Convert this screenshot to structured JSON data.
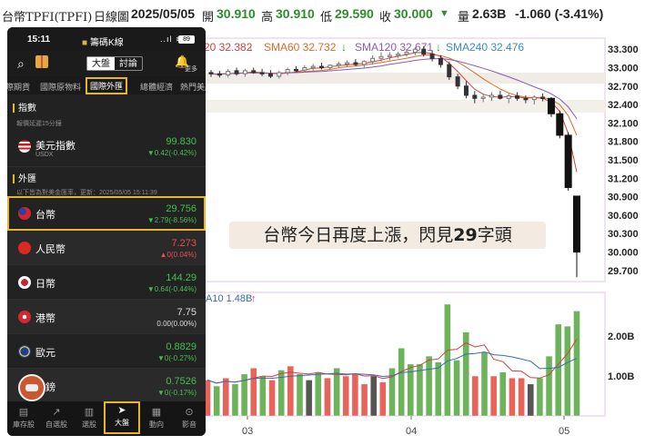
{
  "header": {
    "title": "台幣TPFI(TPFI)",
    "period": "日線圖",
    "date": "2025/05/05",
    "open_label": "開",
    "open": "30.910",
    "high_label": "高",
    "high": "30.910",
    "low_label": "低",
    "low": "29.590",
    "close_label": "收",
    "close": "30.000",
    "close_arrow": "▼",
    "volume_label": "量",
    "volume": "2.63B",
    "change": "-1.060 (-3.41%)"
  },
  "sma": {
    "sma20": "20 32.382",
    "sma60": "SMA60 32.732",
    "sma120": "SMA120 32.671",
    "sma240": "SMA240 32.476",
    "arrow": "↓",
    "colors": {
      "sma20": "#d04040",
      "sma60": "#e06a2a",
      "sma120": "#8a5ab0",
      "sma240": "#3a8ad0"
    }
  },
  "volume_label": "A10 1.48B",
  "volume_arrow": "↑",
  "annotation": {
    "prefix": "台幣今日再度上漲，閃見",
    "highlight": "29",
    "suffix": "字頭"
  },
  "phone": {
    "status": {
      "time": "15:11",
      "app": "籌碼K線",
      "battery": "89"
    },
    "segment": [
      "大盤",
      "討論"
    ],
    "more": "更多",
    "tabs": [
      "際期貨",
      "國際原物料",
      "國際外匯",
      "總體經濟",
      "熱門美股"
    ],
    "sections": {
      "index_title": "指數",
      "index_note": "報價延遲15分鐘",
      "fx_title": "外匯",
      "fx_note": "以下皆為對美金匯率，更新：2025/05/05 15:11:39"
    },
    "rows": [
      {
        "name": "美元指數",
        "sub": "USDX",
        "price": "99.830",
        "change": "▼0.42(-0.42%)"
      },
      {
        "name": "台幣",
        "sub": "",
        "price": "29.756",
        "change": "▼2.79(-8.56%)"
      },
      {
        "name": "人民幣",
        "sub": "",
        "price": "7.273",
        "change": "▲0(0.04%)"
      },
      {
        "name": "日幣",
        "sub": "",
        "price": "144.29",
        "change": "▼0.64(-0.44%)"
      },
      {
        "name": "港幣",
        "sub": "",
        "price": "7.75",
        "change": "0.00(0.00%)"
      },
      {
        "name": "歐元",
        "sub": "",
        "price": "0.8829",
        "change": "▼0(-0.27%)"
      },
      {
        "name": "英鎊",
        "sub": "",
        "price": "0.7526",
        "change": "▼0(-0.17%)"
      }
    ],
    "nav": [
      "庫存股",
      "自選股",
      "選股",
      "大盤",
      "動向",
      "影音"
    ]
  },
  "chart_data": {
    "type": "candlestick",
    "price_axis": {
      "ticks": [
        "33.300",
        "33.000",
        "32.700",
        "32.400",
        "32.100",
        "31.800",
        "31.500",
        "31.200",
        "30.900",
        "30.600",
        "30.300",
        "30.000",
        "29.700"
      ],
      "range": [
        29.55,
        33.45
      ]
    },
    "volume_axis": {
      "ticks": [
        "2.00B",
        "1.00B"
      ]
    },
    "x_ticks": [
      "03",
      "04",
      "05"
    ],
    "candles": [
      {
        "o": 32.92,
        "h": 32.96,
        "l": 32.85,
        "c": 32.9
      },
      {
        "o": 32.9,
        "h": 32.95,
        "l": 32.84,
        "c": 32.88
      },
      {
        "o": 32.88,
        "h": 32.98,
        "l": 32.84,
        "c": 32.94
      },
      {
        "o": 32.95,
        "h": 33.0,
        "l": 32.87,
        "c": 32.9
      },
      {
        "o": 32.9,
        "h": 32.98,
        "l": 32.85,
        "c": 32.95
      },
      {
        "o": 32.95,
        "h": 33.0,
        "l": 32.9,
        "c": 32.92
      },
      {
        "o": 32.92,
        "h": 32.98,
        "l": 32.86,
        "c": 32.9
      },
      {
        "o": 32.9,
        "h": 32.96,
        "l": 32.83,
        "c": 32.86
      },
      {
        "o": 32.86,
        "h": 32.95,
        "l": 32.82,
        "c": 32.92
      },
      {
        "o": 32.92,
        "h": 33.0,
        "l": 32.88,
        "c": 32.97
      },
      {
        "o": 32.97,
        "h": 33.02,
        "l": 32.92,
        "c": 32.96
      },
      {
        "o": 32.96,
        "h": 33.04,
        "l": 32.92,
        "c": 33.0
      },
      {
        "o": 33.0,
        "h": 33.06,
        "l": 32.95,
        "c": 33.02
      },
      {
        "o": 33.02,
        "h": 33.08,
        "l": 32.97,
        "c": 33.0
      },
      {
        "o": 33.0,
        "h": 33.05,
        "l": 32.96,
        "c": 33.04
      },
      {
        "o": 33.04,
        "h": 33.1,
        "l": 33.0,
        "c": 33.06
      },
      {
        "o": 33.06,
        "h": 33.12,
        "l": 33.01,
        "c": 33.08
      },
      {
        "o": 33.08,
        "h": 33.14,
        "l": 33.02,
        "c": 33.05
      },
      {
        "o": 33.05,
        "h": 33.12,
        "l": 33.0,
        "c": 33.1
      },
      {
        "o": 33.1,
        "h": 33.2,
        "l": 33.05,
        "c": 33.15
      },
      {
        "o": 33.15,
        "h": 33.25,
        "l": 33.1,
        "c": 33.18
      },
      {
        "o": 33.18,
        "h": 33.25,
        "l": 33.12,
        "c": 33.2
      },
      {
        "o": 33.2,
        "h": 33.26,
        "l": 33.15,
        "c": 33.22
      },
      {
        "o": 33.22,
        "h": 33.3,
        "l": 33.18,
        "c": 33.25
      },
      {
        "o": 33.25,
        "h": 33.33,
        "l": 33.2,
        "c": 33.3
      },
      {
        "o": 33.3,
        "h": 33.35,
        "l": 33.18,
        "c": 33.22
      },
      {
        "o": 33.22,
        "h": 33.28,
        "l": 33.1,
        "c": 33.15
      },
      {
        "o": 33.15,
        "h": 33.2,
        "l": 33.0,
        "c": 33.05
      },
      {
        "o": 33.05,
        "h": 33.1,
        "l": 32.8,
        "c": 32.85
      },
      {
        "o": 32.85,
        "h": 32.9,
        "l": 32.65,
        "c": 32.7
      },
      {
        "o": 32.7,
        "h": 32.78,
        "l": 32.5,
        "c": 32.55
      },
      {
        "o": 32.55,
        "h": 32.62,
        "l": 32.42,
        "c": 32.5
      },
      {
        "o": 32.5,
        "h": 32.58,
        "l": 32.44,
        "c": 32.52
      },
      {
        "o": 32.52,
        "h": 32.6,
        "l": 32.46,
        "c": 32.55
      },
      {
        "o": 32.55,
        "h": 32.62,
        "l": 32.48,
        "c": 32.5
      },
      {
        "o": 32.5,
        "h": 32.58,
        "l": 32.42,
        "c": 32.54
      },
      {
        "o": 32.54,
        "h": 32.6,
        "l": 32.46,
        "c": 32.5
      },
      {
        "o": 32.5,
        "h": 32.55,
        "l": 32.42,
        "c": 32.48
      },
      {
        "o": 32.48,
        "h": 32.55,
        "l": 32.4,
        "c": 32.52
      },
      {
        "o": 32.52,
        "h": 32.58,
        "l": 32.45,
        "c": 32.5
      },
      {
        "o": 32.5,
        "h": 32.52,
        "l": 32.2,
        "c": 32.25
      },
      {
        "o": 32.25,
        "h": 32.3,
        "l": 31.85,
        "c": 31.9
      },
      {
        "o": 31.9,
        "h": 31.95,
        "l": 31.0,
        "c": 31.05
      },
      {
        "o": 30.91,
        "h": 30.91,
        "l": 29.59,
        "c": 30.0
      }
    ],
    "volumes": [
      {
        "v": 0.9,
        "d": "dn"
      },
      {
        "v": 0.75,
        "d": "up"
      },
      {
        "v": 0.95,
        "d": "dn"
      },
      {
        "v": 0.8,
        "d": "up"
      },
      {
        "v": 1.05,
        "d": "up"
      },
      {
        "v": 1.2,
        "d": "dn"
      },
      {
        "v": 1.0,
        "d": "up"
      },
      {
        "v": 0.9,
        "d": "dn"
      },
      {
        "v": 1.15,
        "d": "up"
      },
      {
        "v": 1.25,
        "d": "dn"
      },
      {
        "v": 1.05,
        "d": "up"
      },
      {
        "v": 0.9,
        "d": "flat"
      },
      {
        "v": 1.1,
        "d": "up"
      },
      {
        "v": 0.95,
        "d": "dn"
      },
      {
        "v": 1.2,
        "d": "up"
      },
      {
        "v": 1.0,
        "d": "dn"
      },
      {
        "v": 1.05,
        "d": "dn"
      },
      {
        "v": 0.8,
        "d": "dn"
      },
      {
        "v": 1.0,
        "d": "flat"
      },
      {
        "v": 0.85,
        "d": "dn"
      },
      {
        "v": 1.2,
        "d": "up"
      },
      {
        "v": 1.7,
        "d": "up"
      },
      {
        "v": 1.3,
        "d": "up"
      },
      {
        "v": 1.3,
        "d": "up"
      },
      {
        "v": 1.5,
        "d": "up"
      },
      {
        "v": 1.35,
        "d": "up"
      },
      {
        "v": 2.8,
        "d": "up"
      },
      {
        "v": 1.4,
        "d": "up"
      },
      {
        "v": 2.1,
        "d": "up"
      },
      {
        "v": 1.0,
        "d": "dn"
      },
      {
        "v": 1.6,
        "d": "up"
      },
      {
        "v": 1.0,
        "d": "dn"
      },
      {
        "v": 1.1,
        "d": "up"
      },
      {
        "v": 0.95,
        "d": "dn"
      },
      {
        "v": 0.95,
        "d": "dn"
      },
      {
        "v": 0.8,
        "d": "flat"
      },
      {
        "v": 0.95,
        "d": "up"
      },
      {
        "v": 1.5,
        "d": "up"
      },
      {
        "v": 2.3,
        "d": "up"
      },
      {
        "v": 2.25,
        "d": "up"
      },
      {
        "v": 2.63,
        "d": "up"
      }
    ]
  }
}
